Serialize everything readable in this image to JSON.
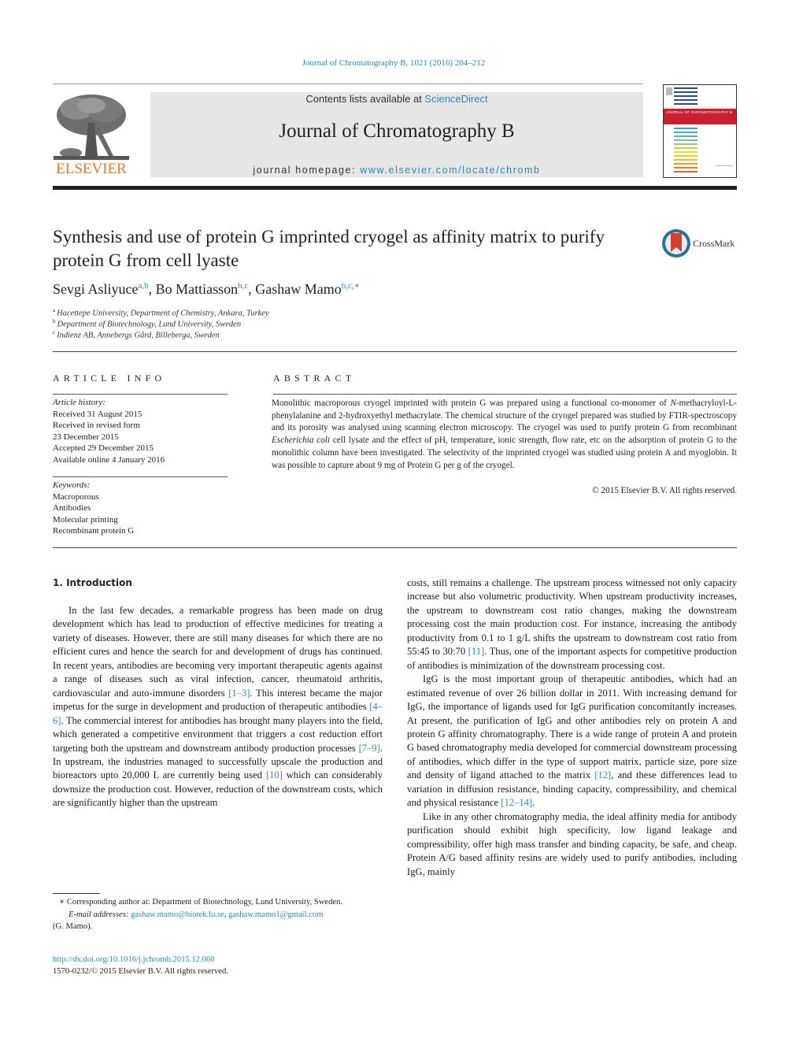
{
  "header": {
    "citation": "Journal of Chromatography B, 1021 (2016) 204–212",
    "contents_prefix": "Contents lists available at ",
    "contents_link": "ScienceDirect",
    "journal_title": "Journal of Chromatography B",
    "homepage_prefix": "journal homepage: ",
    "homepage_link": "www.elsevier.com/locate/chromb",
    "publisher_logo": "ELSEVIER",
    "cover_title": "JOURNAL OF CHROMATOGRAPHY B",
    "colors": {
      "link": "#2a8ab7",
      "elsevier_orange": "#e8772a",
      "cover_red": "#c8202f",
      "masthead_grey": "#e6e6e6"
    }
  },
  "article": {
    "title": "Synthesis and use of protein G imprinted cryogel as affinity matrix to purify protein G from cell lyaste",
    "crossmark_label": "CrossMark",
    "authors": [
      {
        "name": "Sevgi Asliyuce",
        "sup": "a,b",
        "sep": ", "
      },
      {
        "name": "Bo Mattiasson",
        "sup": "b,c",
        "sep": ", "
      },
      {
        "name": "Gashaw Mamo",
        "sup": "b,c,∗",
        "sep": ""
      }
    ],
    "affiliations": [
      {
        "mark": "a",
        "text": "Hacettepe University, Department of Chemistry, Ankara, Turkey"
      },
      {
        "mark": "b",
        "text": "Department of Biotechnology, Lund University, Sweden"
      },
      {
        "mark": "c",
        "text": "Indienz AB, Annebergs Gård, Billeberga, Sweden"
      }
    ]
  },
  "article_info": {
    "heading": "ARTICLE INFO",
    "history_label": "Article history:",
    "history": [
      "Received 31 August 2015",
      "Received in revised form",
      "23 December 2015",
      "Accepted 29 December 2015",
      "Available online 4 January 2016"
    ],
    "keywords_label": "Keywords:",
    "keywords": [
      "Macroporous",
      "Antibodies",
      "Molecular printing",
      "Recombinant protein G"
    ]
  },
  "abstract": {
    "heading": "ABSTRACT",
    "p1": "Monolithic macroporous cryogel imprinted with protein G was prepared using a functional co-monomer of ",
    "p1_italic": "N",
    "p2": "-methacryloyl-L-phenylalanine and 2-hydroxyethyl methacrylate. The chemical structure of the cryogel prepared was studied by FTIR-spectroscopy and its porosity was analysed using scanning electron microscopy. The cryogel was used to purify protein G from recombinant ",
    "p2_italic": "Escherichia coli",
    "p3": " cell lysate and the effect of pH, temperature, ionic strength, flow rate, etc on the adsorption of protein G to the monolithic column have been investigated. The selectivity of the imprinted cryogel was studied using protein A and myoglobin. It was possible to capture about 9 mg of Protein G per g of the cryogel.",
    "copyright": "© 2015 Elsevier B.V. All rights reserved."
  },
  "body": {
    "section_heading": "1.  Introduction",
    "left_p1": [
      {
        "t": "In the last few decades, a remarkable progress has been made on drug development which has lead to production of effective medicines for treating a variety of diseases. However, there are still many diseases for which there are no efficient cures and hence the search for and development of drugs has continued. In recent years, antibodies are becoming very important therapeutic agents against a range of diseases such as viral infection, cancer, rheumatoid arthritis, cardiovascular and auto-immune disorders "
      },
      {
        "c": "[1–3]"
      },
      {
        "t": ". This interest became the major impetus for the surge in development and production of therapeutic antibodies "
      },
      {
        "c": "[4–6]"
      },
      {
        "t": ". The commercial interest for antibodies has brought many players into the field, which generated a competitive environment that triggers a cost reduction effort targeting both the upstream and downstream antibody production processes "
      },
      {
        "c": "[7–9]"
      },
      {
        "t": ". In upstream, the industries managed to successfully upscale the production and bioreactors upto 20,000 L are currently being used "
      },
      {
        "c": "[10]"
      },
      {
        "t": " which can considerably downsize the production cost. However, reduction of the downstream costs, which are significantly higher than the upstream"
      }
    ],
    "right_p1": [
      {
        "t": "costs, still remains a challenge. The upstream process witnessed not only capacity increase but also volumetric productivity. When upstream productivity increases, the upstream to downstream cost ratio changes, making the downstream processing cost the main production cost. For instance, increasing the antibody productivity from 0.1 to 1 g/L shifts the upstream to downstream cost ratio from 55:45 to 30:70 "
      },
      {
        "c": "[11]"
      },
      {
        "t": ". Thus, one of the important aspects for competitive production of antibodies is minimization of the downstream processing cost."
      }
    ],
    "right_p2": [
      {
        "t": "IgG is the most important group of therapeutic antibodies, which had an estimated revenue of over 26 billion dollar in 2011. With increasing demand for IgG, the importance of ligands used for IgG purification concomitantly increases. At present, the purification of IgG and other antibodies rely on protein A and protein G affinity chromatography. There is a wide range of protein A and protein G based chromatography media developed for commercial downstream processing of antibodies, which differ in the type of support matrix, particle size, pore size and density of ligand attached to the matrix "
      },
      {
        "c": "[12]"
      },
      {
        "t": ", and these differences lead to variation in diffusion resistance, binding capacity, compressibility, and chemical and physical resistance "
      },
      {
        "c": "[12–14]"
      },
      {
        "t": "."
      }
    ],
    "right_p3": [
      {
        "t": "Like in any other chromatography media, the ideal affinity media for antibody purification should exhibit high specificity, low ligand leakage and compressibility, offer high mass transfer and binding capacity, be safe, and cheap. Protein A/G based affinity resins are widely used to purify antibodies, including IgG, mainly"
      }
    ]
  },
  "footnote": {
    "corresponding": "∗  Corresponding author at: Department of Biotechnology, Lund University, Sweden.",
    "email_label": "E-mail addresses: ",
    "email1": "gashaw.mamo@biotek.lu.se",
    "email_sep": ", ",
    "email2": "gashaw.mamo1@gmail.com",
    "email_suffix": "(G. Mamo).",
    "doi": "http://dx.doi.org/10.1016/j.jchromb.2015.12.060",
    "issn_line": "1570-0232/© 2015 Elsevier B.V. All rights reserved."
  }
}
